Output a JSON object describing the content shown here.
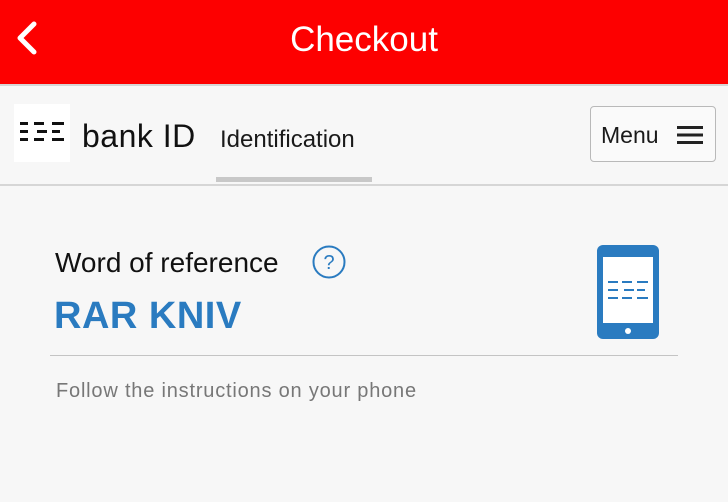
{
  "topbar": {
    "title": "Checkout",
    "background": "#fd0000",
    "back_icon": "chevron-left-icon"
  },
  "header": {
    "logo_icon": "bankid-logo-icon",
    "brand_text": "bank ID",
    "active_tab": "Identification",
    "menu_label": "Menu",
    "menu_icon": "hamburger-icon"
  },
  "main": {
    "reference_label": "Word of reference",
    "help_icon": "question-circle-icon",
    "reference_value": "RAR KNIV",
    "phone_icon": "mobile-phone-icon",
    "instructions": "Follow the instructions on your phone",
    "accent_color": "#2a7bc0"
  }
}
